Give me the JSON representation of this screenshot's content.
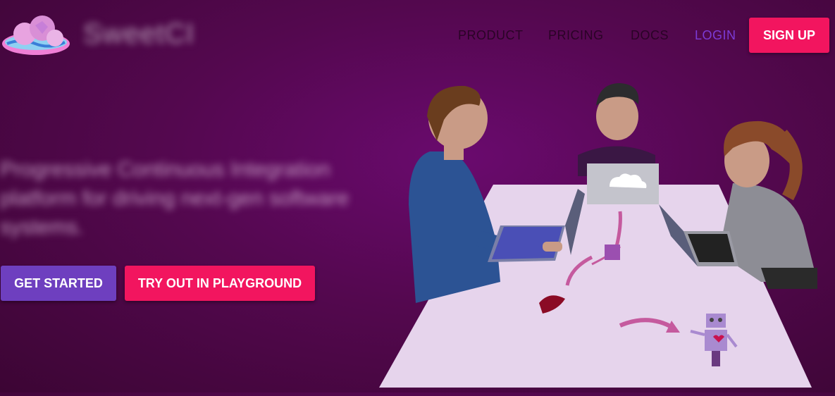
{
  "brand": {
    "name": "SweetCI",
    "logo_icon": "cloud-logo-icon"
  },
  "nav": {
    "product": "PRODUCT",
    "pricing": "PRICING",
    "docs": "DOCS",
    "login": "LOGIN",
    "signup": "SIGN UP"
  },
  "hero": {
    "tagline": "Progressive Continuous Integration platform for driving next-gen software systems.",
    "get_started": "GET STARTED",
    "playground": "TRY OUT IN PLAYGROUND"
  },
  "colors": {
    "accent": "#f2155f",
    "secondary": "#6e3fbf",
    "login": "#7c3bd6",
    "background": "#54084f"
  },
  "illustration": {
    "icons": [
      "team-illustration",
      "cloud-laptop-icon",
      "robot-icon",
      "heart-icon"
    ]
  }
}
